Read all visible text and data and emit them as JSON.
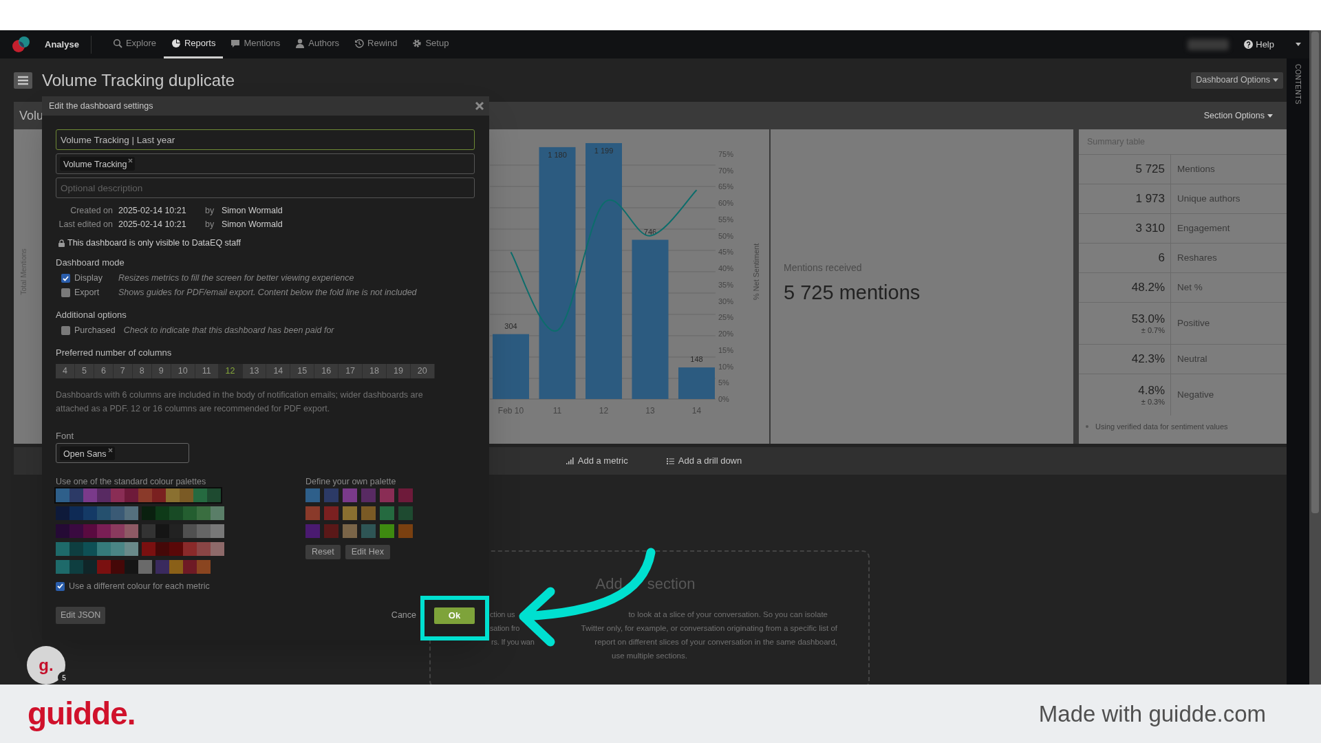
{
  "nav": {
    "brand": "Analyse",
    "items": [
      {
        "label": "Explore",
        "selected": false
      },
      {
        "label": "Reports",
        "selected": true
      },
      {
        "label": "Mentions",
        "selected": false
      },
      {
        "label": "Authors",
        "selected": false
      },
      {
        "label": "Rewind",
        "selected": false
      },
      {
        "label": "Setup",
        "selected": false
      }
    ],
    "help": "Help"
  },
  "header": {
    "title": "Volume Tracking duplicate",
    "options_button": "Dashboard Options"
  },
  "contents_tab": "CONTENTS",
  "section": {
    "title": "Volu",
    "options_button": "Section Options",
    "chart": {
      "chart_data": {
        "type": "bar",
        "categories": [
          "Feb 10",
          "11",
          "12",
          "13",
          "14"
        ],
        "series": [
          {
            "name": "Total Mentions",
            "color": "#2c5b80",
            "values": [
              304,
              1180,
              1199,
              746,
              148
            ]
          }
        ],
        "data_labels": true,
        "value_labels": [
          "304",
          "1 180",
          "1 199",
          "746",
          "148"
        ]
      }
    },
    "sentiment_chart": {
      "chart_data": {
        "type": "line",
        "series": [
          {
            "name": "% Net Sentiment",
            "color": "#0c6d6b",
            "values": [
              45,
              21,
              60,
              50,
              64
            ]
          }
        ],
        "ylim": [
          0,
          75
        ],
        "yticks": [
          {
            "value": 75,
            "label": "75%"
          },
          {
            "value": 70,
            "label": "70%"
          },
          {
            "value": 65,
            "label": "65%"
          },
          {
            "value": 60,
            "label": "60%"
          },
          {
            "value": 55,
            "label": "55%"
          },
          {
            "value": 50,
            "label": "50%"
          },
          {
            "value": 45,
            "label": "45%"
          },
          {
            "value": 40,
            "label": "40%"
          },
          {
            "value": 35,
            "label": "35%"
          },
          {
            "value": 30,
            "label": "30%"
          },
          {
            "value": 25,
            "label": "25%"
          },
          {
            "value": 20,
            "label": "20%"
          },
          {
            "value": 15,
            "label": "15%"
          },
          {
            "value": 10,
            "label": "10%"
          },
          {
            "value": 5,
            "label": "5%"
          },
          {
            "value": 0,
            "label": "0%"
          }
        ]
      }
    },
    "metric": {
      "label": "Mentions received",
      "value": "5 725 mentions"
    },
    "summary": {
      "title": "Summary table",
      "rows": [
        {
          "value": "5 725",
          "label": "Mentions"
        },
        {
          "value": "1 973",
          "label": "Unique authors"
        },
        {
          "value": "3 310",
          "label": "Engagement"
        },
        {
          "value": "6",
          "label": "Reshares"
        },
        {
          "value": "48.2%",
          "label": "Net %"
        },
        {
          "value": "53.0%",
          "margin": "± 0.7%",
          "label": "Positive"
        },
        {
          "value": "42.3%",
          "label": "Neutral"
        },
        {
          "value": "4.8%",
          "margin": "± 0.3%",
          "label": "Negative"
        }
      ],
      "note": "Using verified data for sentiment values"
    }
  },
  "section_actions": [
    "Add a metric",
    "Add a drill down"
  ],
  "add_section": {
    "title_parts": [
      "Add",
      "section"
    ],
    "lines": [
      [
        "ction us",
        "to look at a slice of your conversation. So you can isolate"
      ],
      [
        "sation fro",
        "Twitter only, for example, or conversation originating from a specific list of"
      ],
      [
        "rs. If you wan",
        "report on different slices of your conversation in the same dashboard,"
      ],
      [
        "use multiple sections."
      ]
    ]
  },
  "dialog": {
    "title": "Edit the dashboard settings",
    "name_value": "Volume Tracking | Last year",
    "tags": [
      "Volume Tracking"
    ],
    "description_placeholder": "Optional description",
    "meta": [
      {
        "label": "Created on",
        "date": "2025-02-14 10:21",
        "by": "by",
        "author": "Simon Wormald"
      },
      {
        "label": "Last edited on",
        "date": "2025-02-14 10:21",
        "by": "by",
        "author": "Simon Wormald"
      }
    ],
    "visibility": "This dashboard is only visible to DataEQ staff",
    "mode_title": "Dashboard mode",
    "modes": [
      {
        "label": "Display",
        "description": "Resizes metrics to fill the screen for better viewing experience",
        "checked": true
      },
      {
        "label": "Export",
        "description": "Shows guides for PDF/email export. Content below the fold line is not included",
        "checked": false
      }
    ],
    "options_title": "Additional options",
    "options": [
      {
        "label": "Purchased",
        "description": "Check to indicate that this dashboard has been paid for",
        "checked": false
      }
    ],
    "columns_title": "Preferred number of columns",
    "columns": [
      {
        "label": "4",
        "selected": false
      },
      {
        "label": "5",
        "selected": false
      },
      {
        "label": "6",
        "selected": false
      },
      {
        "label": "7",
        "selected": false
      },
      {
        "label": "8",
        "selected": false
      },
      {
        "label": "9",
        "selected": false
      },
      {
        "label": "10",
        "selected": false
      },
      {
        "label": "11",
        "selected": false
      },
      {
        "label": "12",
        "selected": true
      },
      {
        "label": "13",
        "selected": false
      },
      {
        "label": "14",
        "selected": false
      },
      {
        "label": "15",
        "selected": false
      },
      {
        "label": "16",
        "selected": false
      },
      {
        "label": "17",
        "selected": false
      },
      {
        "label": "18",
        "selected": false
      },
      {
        "label": "19",
        "selected": false
      },
      {
        "label": "20",
        "selected": false
      }
    ],
    "columns_note": "Dashboards with 6 columns are included in the body of notification emails; wider dashboards are attached as a PDF. 12 or 16 columns are recommended for PDF export.",
    "font_title": "Font",
    "font_tags": [
      "Open Sans"
    ],
    "standard_title": "Use one of the standard colour palettes",
    "standard_palettes": [
      {
        "selected": true,
        "swatches": [
          {
            "color": "#2e5f8a"
          },
          {
            "color": "#2c3a66"
          },
          {
            "color": "#7a3a8a"
          },
          {
            "color": "#582a62"
          },
          {
            "color": "#8a2d55"
          },
          {
            "color": "#6e1a3a"
          },
          {
            "color": "#8a3a2a"
          },
          {
            "color": "#7a2020"
          },
          {
            "color": "#8a7030"
          },
          {
            "color": "#7a5a25"
          },
          {
            "color": "#256a40"
          },
          {
            "color": "#1e4a30"
          }
        ]
      },
      {
        "selected": false,
        "swatches": [
          {
            "color": "#0e1a3a"
          },
          {
            "color": "#0e2a55"
          },
          {
            "color": "#143a66"
          },
          {
            "color": "#25506e"
          },
          {
            "color": "#3a5a75"
          },
          {
            "color": "#55707e"
          }
        ]
      },
      {
        "selected": false,
        "swatches": [
          {
            "color": "#0a200f"
          },
          {
            "color": "#0e3a18"
          },
          {
            "color": "#184a25"
          },
          {
            "color": "#245e30"
          },
          {
            "color": "#3a6e40"
          },
          {
            "color": "#5a7e68"
          }
        ]
      },
      {
        "selected": false,
        "swatches": [
          {
            "color": "#250a35"
          },
          {
            "color": "#3a0a40"
          },
          {
            "color": "#5a0a40"
          },
          {
            "color": "#7a1e55"
          },
          {
            "color": "#8a3a5e"
          },
          {
            "color": "#8e5a65"
          }
        ]
      },
      {
        "selected": false,
        "swatches": [
          {
            "color": "#333333"
          },
          {
            "color": "#151515"
          },
          {
            "color": "#222222"
          },
          {
            "color": "#505050"
          },
          {
            "color": "#656565"
          },
          {
            "color": "#787878"
          }
        ]
      },
      {
        "selected": false,
        "swatches": [
          {
            "color": "#1e6a6a"
          },
          {
            "color": "#0e3e40"
          },
          {
            "color": "#0e5055"
          },
          {
            "color": "#357a7a"
          },
          {
            "color": "#4a8585"
          },
          {
            "color": "#6a8a8a"
          }
        ]
      },
      {
        "selected": false,
        "swatches": [
          {
            "color": "#7a1010"
          },
          {
            "color": "#450808"
          },
          {
            "color": "#5a0808"
          },
          {
            "color": "#8a2a2a"
          },
          {
            "color": "#8a4545"
          },
          {
            "color": "#8e6a6a"
          }
        ]
      },
      {
        "selected": false,
        "swatches": [
          {
            "color": "#1e6a6a"
          },
          {
            "color": "#0e3e40"
          },
          {
            "color": "#102528"
          },
          {
            "color": "#7a1010"
          },
          {
            "color": "#450808"
          },
          {
            "color": "#151515"
          },
          {
            "color": "#6a6a6a"
          }
        ]
      },
      {
        "selected": false,
        "swatches": [
          {
            "color": "#3a2a5e"
          },
          {
            "color": "#8a6018"
          },
          {
            "color": "#6e1a25"
          },
          {
            "color": "#8a4520"
          }
        ]
      }
    ],
    "custom_title": "Define your own palette",
    "custom_swatches": [
      {
        "color": "#2e5f8a"
      },
      {
        "color": "#2c3a66"
      },
      {
        "color": "#7a3a8a"
      },
      {
        "color": "#582a62"
      },
      {
        "color": "#8a2d55"
      },
      {
        "color": "#6e1a3a"
      },
      {
        "color": "#8a3a2a"
      },
      {
        "color": "#7a2020"
      },
      {
        "color": "#8a7030"
      },
      {
        "color": "#7a5a25"
      },
      {
        "color": "#256a40"
      },
      {
        "color": "#1e4a30"
      },
      {
        "color": "#4a1a70"
      },
      {
        "color": "#5a1818"
      },
      {
        "color": "#7a6548"
      },
      {
        "color": "#2e5555"
      },
      {
        "color": "#3e8a10"
      },
      {
        "color": "#7a4010"
      }
    ],
    "custom_buttons": [
      "Reset",
      "Edit Hex"
    ],
    "distinct_colours": {
      "label": "Use a different colour for each metric",
      "checked": true
    },
    "json_button": "Edit JSON",
    "cancel": "Cance",
    "ok": "Ok"
  },
  "tutorial": {
    "badge": "5",
    "avatar": "g."
  },
  "footer": {
    "logo": "guidde.",
    "credit": "Made with guidde.com"
  }
}
